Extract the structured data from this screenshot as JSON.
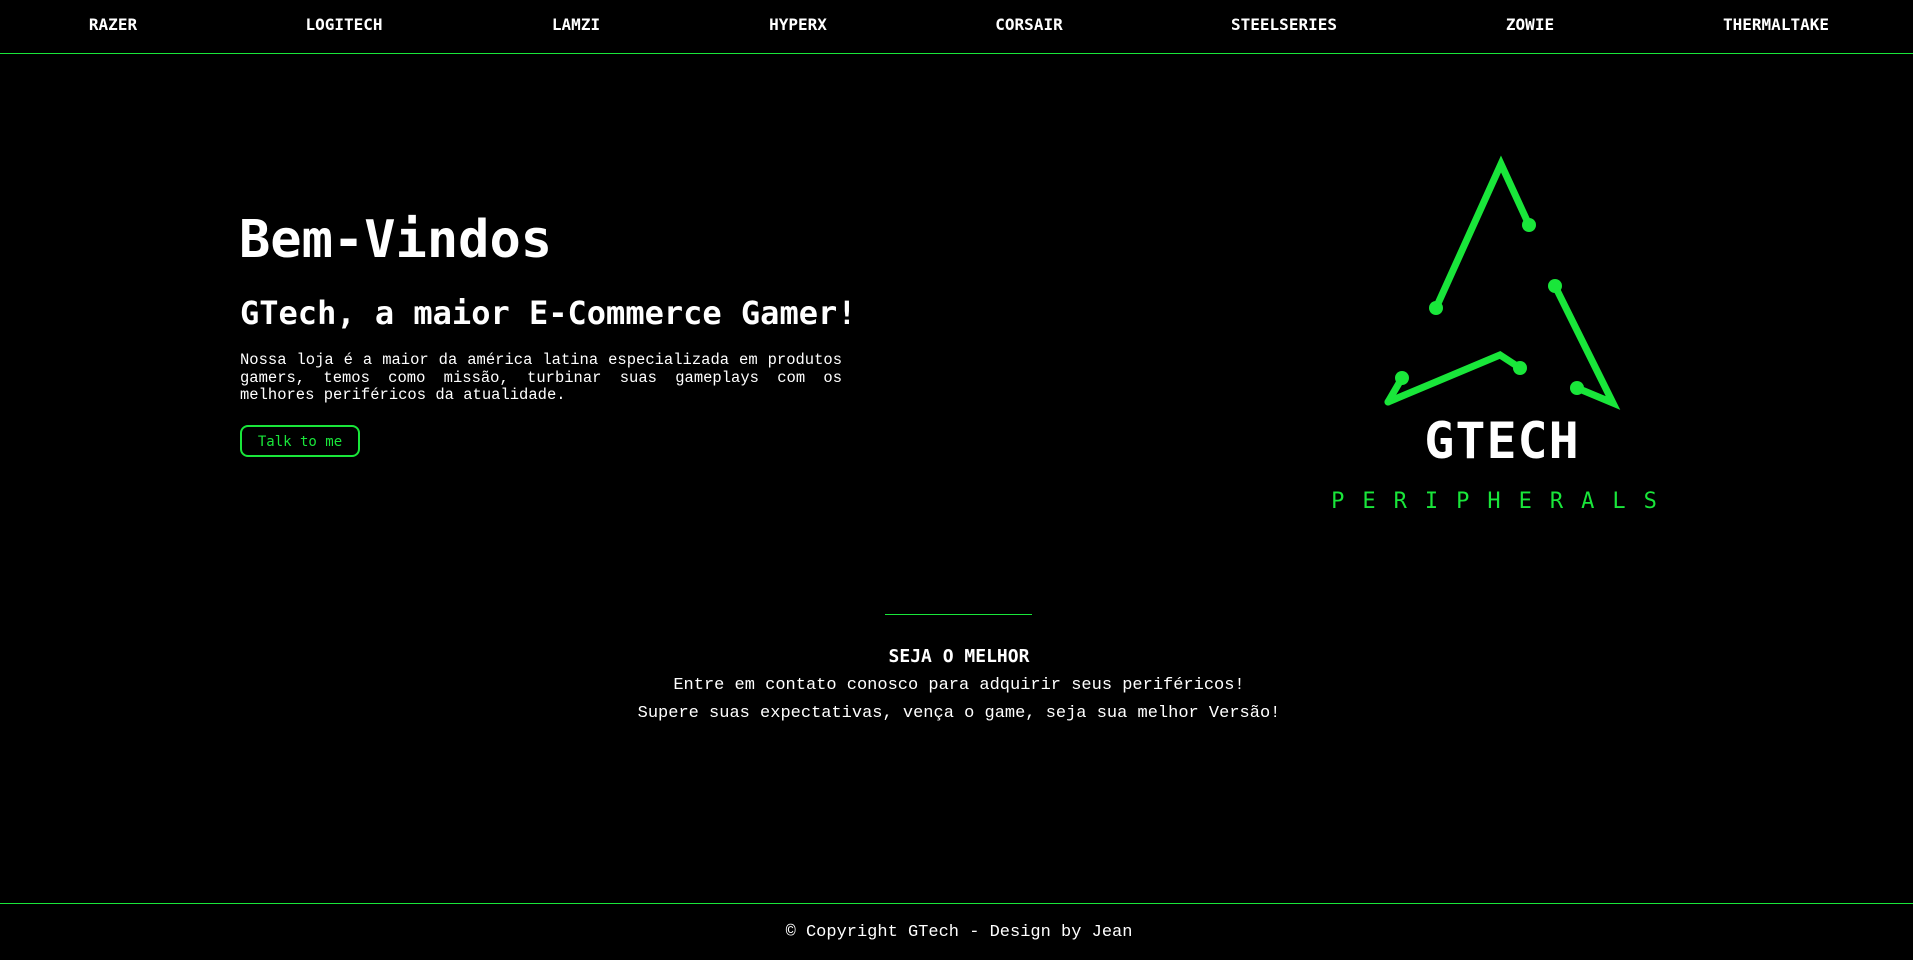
{
  "nav": {
    "items": [
      {
        "label": "RAZER"
      },
      {
        "label": "LOGITECH"
      },
      {
        "label": "LAMZI"
      },
      {
        "label": "HYPERX"
      },
      {
        "label": "CORSAIR"
      },
      {
        "label": "STEELSERIES"
      },
      {
        "label": "ZOWIE"
      },
      {
        "label": "THERMALTAKE"
      }
    ]
  },
  "hero": {
    "title": "Bem-Vindos",
    "subtitle": "GTech, a maior E-Commerce Gamer!",
    "description": "Nossa loja é a maior da américa latina especializada em produtos gamers, temos como missão, turbinar suas gameplays com os melhores periféricos da atualidade.",
    "cta_label": "Talk to me"
  },
  "logo": {
    "wordmark": "GTECH",
    "tagline": "PERIPHERALS",
    "icon": "circuit-triangle-icon"
  },
  "cta": {
    "heading": "SEJA O MELHOR",
    "line1": "Entre em contato conosco para adquirir seus periféricos!",
    "line2": "Supere suas expectativas, vença o game, seja sua melhor Versão!"
  },
  "footer": {
    "copyright": "© Copyright GTech - Design by Jean"
  },
  "colors": {
    "background": "#000000",
    "accent": "#19e63a",
    "text": "#ffffff"
  }
}
